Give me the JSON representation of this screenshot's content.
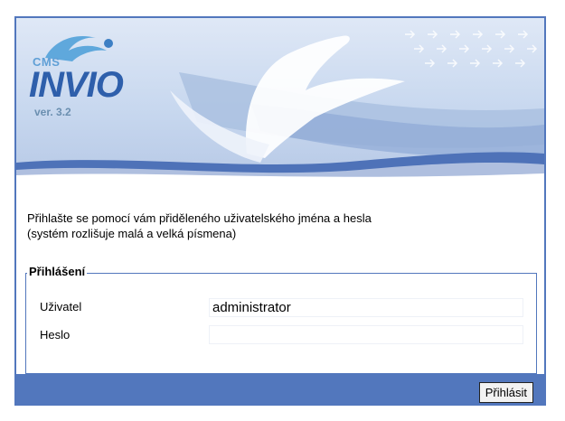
{
  "brand": {
    "cms": "CMS",
    "name": "INVIO",
    "version": "ver. 3.2"
  },
  "intro": {
    "line1": "Přihlašte se pomocí vám přiděleného uživatelského jména a hesla",
    "line2": "(systém rozlišuje malá a velká písmena)"
  },
  "login": {
    "legend": "Přihlášení",
    "user_label": "Uživatel",
    "user_value": "administrator",
    "password_label": "Heslo",
    "password_value": "",
    "submit_label": "Přihlásit"
  },
  "colors": {
    "accent": "#5277bd",
    "logo": "#2e5fab"
  }
}
